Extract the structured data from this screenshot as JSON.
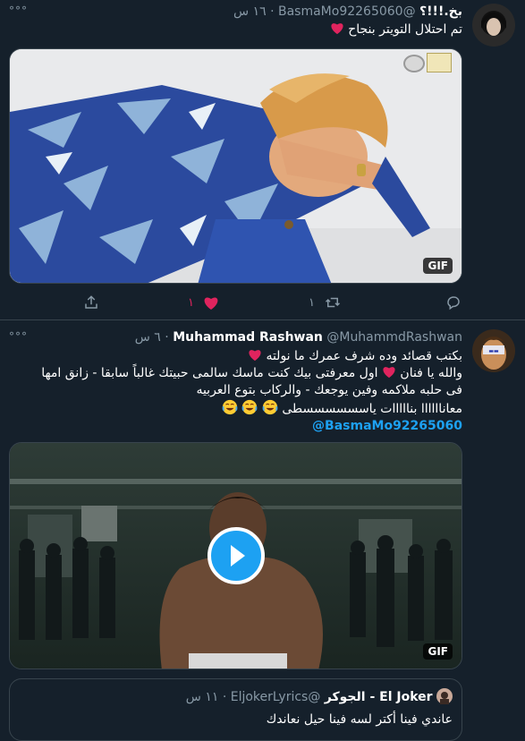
{
  "tweet1": {
    "name": "بخ.!!!؟",
    "handle": "@BasmaMo92265060",
    "separator": "·",
    "time": "١٦ س",
    "more": "°°°",
    "text": "تم احتلال التويتر بنجاح",
    "gif_label": "GIF",
    "actions": {
      "reply_count": "",
      "retweet_count": "١",
      "like_count": "١"
    },
    "liked": true
  },
  "tweet2": {
    "name": "Muhammad Rashwan",
    "handle": "@MuhammdRashwan",
    "separator": "·",
    "time": "٦ س",
    "more": "°°°",
    "line1": "بكتب قصائد وده شرف عمرك ما نولته",
    "line2_a": "والله يا فنان",
    "line2_b": "اول معرفتى بيك كنت ماسك سالمى حبيتك غالباً سابقا - زانق امها",
    "line3": "فى حلبه ملاكمه وفين يوجعك - والركاب بتوع العربيه",
    "line4": "معاناااااا بنااااات ياسسسسسسطى",
    "mention": "@BasmaMo92265060",
    "gif_label": "GIF"
  },
  "quote": {
    "name": "El Joker - الجوكر",
    "handle": "@EljokerLyrics",
    "separator": "·",
    "time": "١١ س",
    "text": "عاندي فينا أكتر لسه فينا حيل نعاندك"
  },
  "colors": {
    "background": "#15202b",
    "like_red": "#e0245e",
    "accent_blue": "#1da1f2",
    "muted": "#8899a6",
    "border": "#38444d"
  }
}
